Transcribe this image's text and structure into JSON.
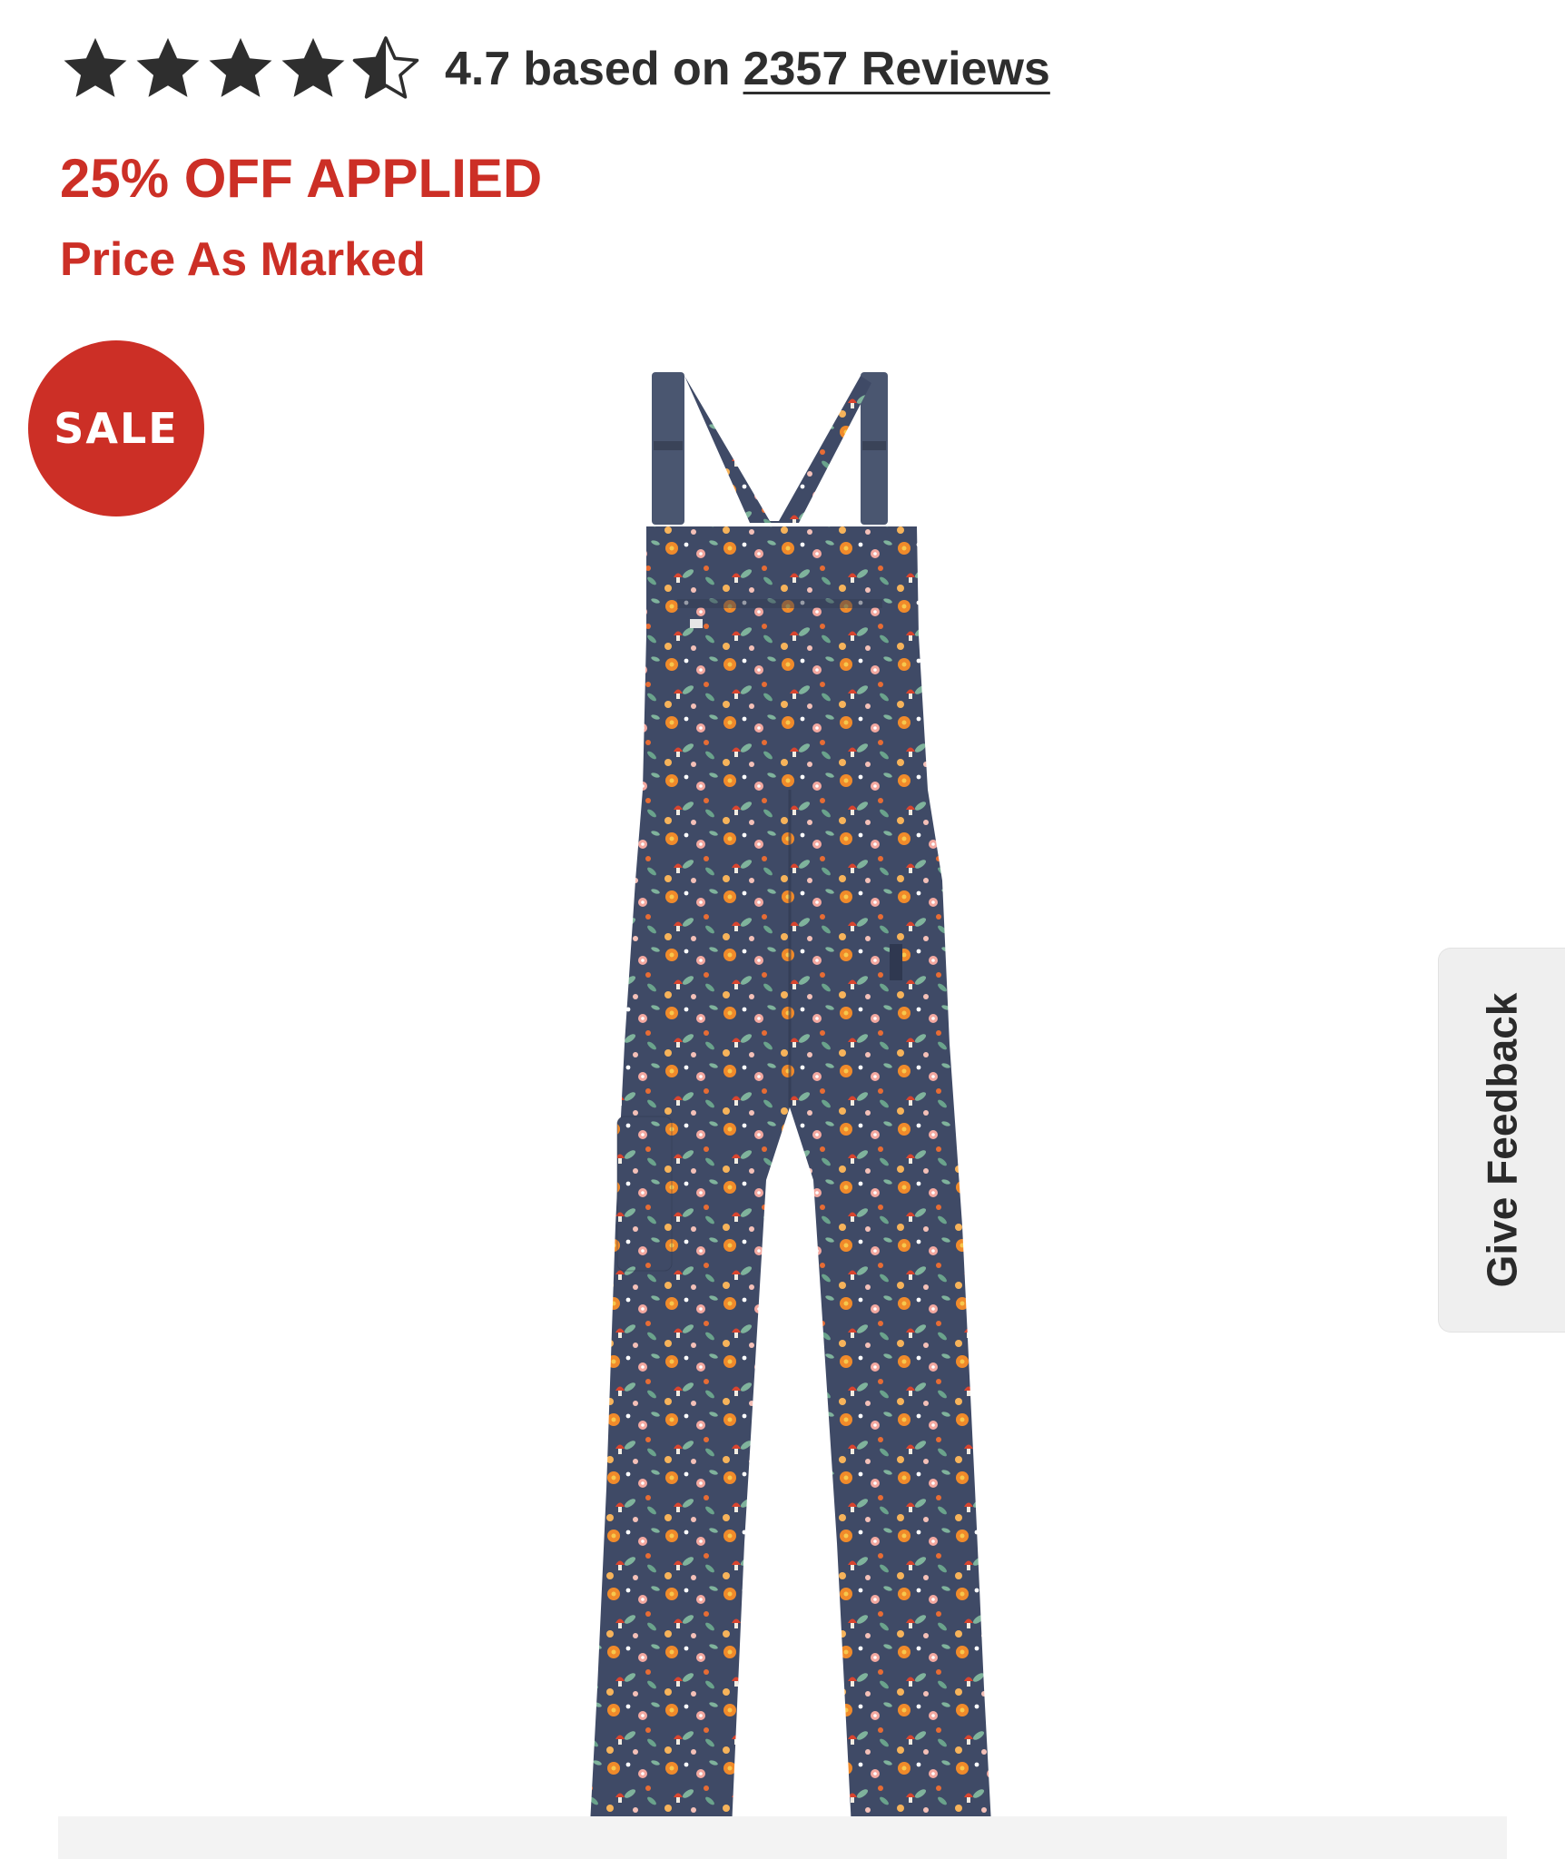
{
  "rating": {
    "value": "4.7",
    "stars_filled": 4.5,
    "stars_total": 5,
    "based_on_text": "based on",
    "reviews_link": "2357 Reviews"
  },
  "promo": {
    "title": "25% OFF APPLIED",
    "subtitle": "Price As Marked"
  },
  "badge": {
    "label": "SALE"
  },
  "product": {
    "image_description": "floral print overalls"
  },
  "feedback": {
    "label": "Give Feedback"
  },
  "colors": {
    "accent_red": "#cc2f26",
    "star_color": "#2e2e2e",
    "feedback_bg": "#efefef"
  }
}
